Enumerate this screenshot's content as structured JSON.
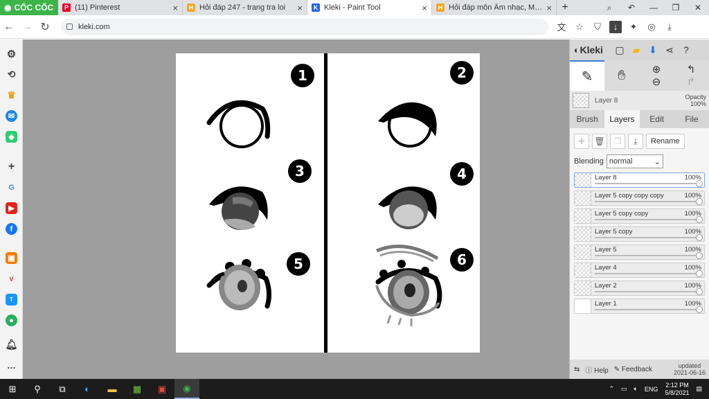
{
  "browser": {
    "brand": "CỐC CỐC",
    "tabs": [
      {
        "title": "(11) Pinterest",
        "color": "#e60023",
        "glyph": "P"
      },
      {
        "title": "Hỏi đáp 247 - trang tra loi",
        "color": "#f5a623",
        "glyph": "H"
      },
      {
        "title": "Kleki - Paint Tool",
        "color": "#2563eb",
        "glyph": "K"
      },
      {
        "title": "Hỏi đáp môn Âm nhạc, Mỹ th",
        "color": "#f5a623",
        "glyph": "H"
      }
    ],
    "url": "kleki.com"
  },
  "canvas": {
    "numbers": [
      "1",
      "2",
      "3",
      "4",
      "5",
      "6"
    ]
  },
  "kleki": {
    "logo": "Kleki",
    "layer_label": "Layer 8",
    "opacity_label": "Opacity",
    "opacity_value": "100%",
    "tabs": [
      "Brush",
      "Layers",
      "Edit",
      "File"
    ],
    "active_tab": "Layers",
    "rename_label": "Rename",
    "blending_label": "Blending",
    "blending_value": "normal",
    "layers": [
      {
        "name": "Layer 8",
        "opacity": "100%"
      },
      {
        "name": "Layer 5 copy copy copy",
        "opacity": "100%"
      },
      {
        "name": "Layer 5 copy copy",
        "opacity": "100%"
      },
      {
        "name": "Layer 5 copy",
        "opacity": "100%"
      },
      {
        "name": "Layer 5",
        "opacity": "100%"
      },
      {
        "name": "Layer 4",
        "opacity": "100%"
      },
      {
        "name": "Layer 2",
        "opacity": "100%"
      },
      {
        "name": "Layer 1",
        "opacity": "100%"
      }
    ],
    "help_label": "Help",
    "feedback_label": "Feedback",
    "updated_label": "updated",
    "updated_date": "2021-06-16"
  },
  "taskbar": {
    "lang": "ENG",
    "time": "2:12 PM",
    "date": "5/8/2021"
  },
  "colors": {
    "brand_green": "#3cb44a",
    "accent_blue": "#3a7bd5"
  }
}
